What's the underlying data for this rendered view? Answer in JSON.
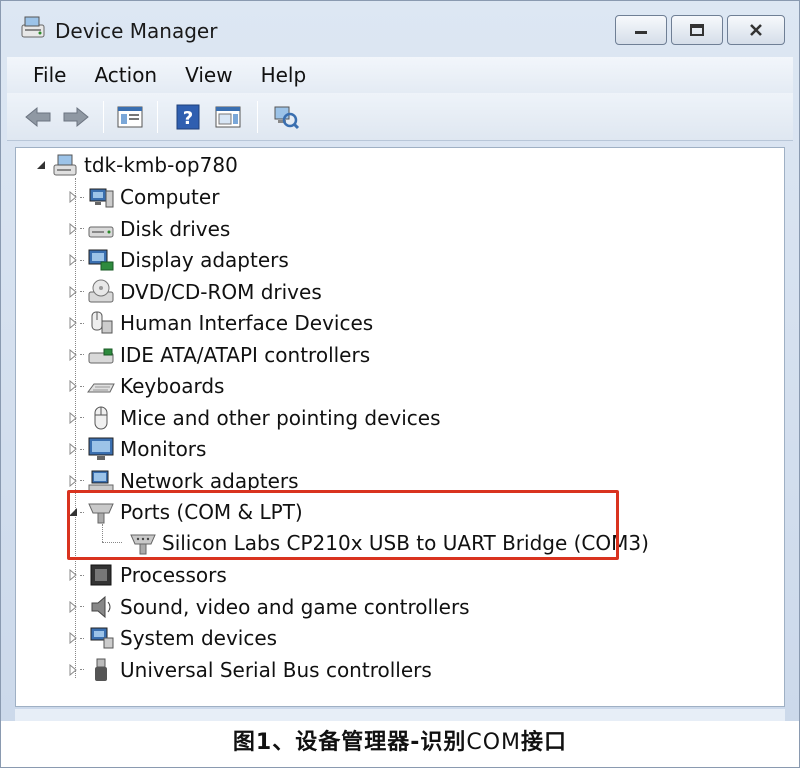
{
  "window": {
    "title": "Device Manager"
  },
  "menu": [
    "File",
    "Action",
    "View",
    "Help"
  ],
  "toolbar": {
    "buttons": [
      "back-icon",
      "forward-icon",
      "show-hide-console-tree-icon",
      "help-icon",
      "properties-icon",
      "scan-hardware-icon"
    ]
  },
  "tree": {
    "root": "tdk-kmb-op780",
    "categories": [
      {
        "label": "Computer",
        "icon": "computer-icon"
      },
      {
        "label": "Disk drives",
        "icon": "disk-drive-icon"
      },
      {
        "label": "Display adapters",
        "icon": "display-adapter-icon"
      },
      {
        "label": "DVD/CD-ROM drives",
        "icon": "dvd-drive-icon"
      },
      {
        "label": "Human Interface Devices",
        "icon": "hid-icon"
      },
      {
        "label": "IDE ATA/ATAPI controllers",
        "icon": "ide-controller-icon"
      },
      {
        "label": "Keyboards",
        "icon": "keyboard-icon"
      },
      {
        "label": "Mice and other pointing devices",
        "icon": "mouse-icon"
      },
      {
        "label": "Monitors",
        "icon": "monitor-icon"
      },
      {
        "label": "Network adapters",
        "icon": "network-adapter-icon"
      },
      {
        "label": "Ports (COM & LPT)",
        "icon": "port-icon",
        "expanded": true
      },
      {
        "label": "Processors",
        "icon": "processor-icon"
      },
      {
        "label": "Sound, video and game controllers",
        "icon": "speaker-icon"
      },
      {
        "label": "System devices",
        "icon": "system-devices-icon"
      },
      {
        "label": "Universal Serial Bus controllers",
        "icon": "usb-icon"
      }
    ],
    "port_child": "Silicon Labs CP210x USB to UART Bridge (COM3)"
  },
  "caption": {
    "prefix": "图1、设备管理器-识别",
    "mono": "COM",
    "suffix": "接口"
  },
  "colors": {
    "highlight": "#d9331f",
    "window_frame": "#cbd8ea"
  }
}
